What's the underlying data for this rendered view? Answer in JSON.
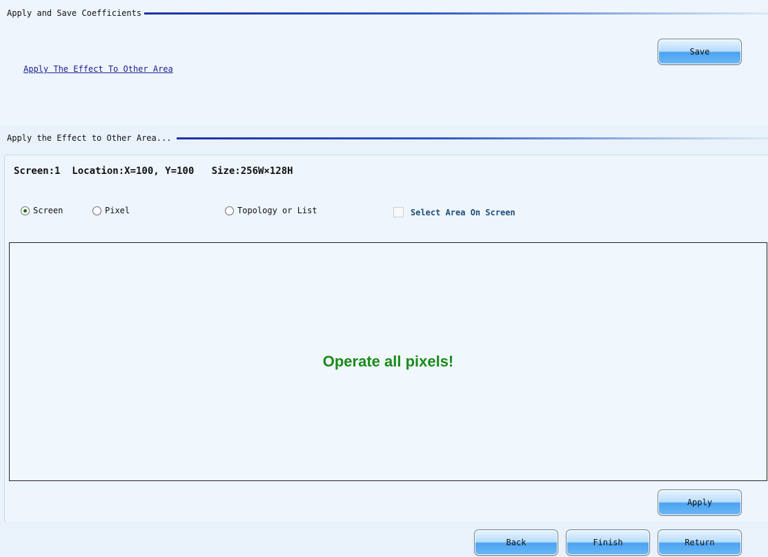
{
  "coefficients_section": {
    "title": "Apply and Save Coefficients",
    "apply_link": "Apply The Effect To Other Area",
    "save_button": "Save"
  },
  "area_section": {
    "title": "Apply the Effect to Other Area...",
    "info": "Screen:1  Location:X=100, Y=100   Size:256W×128H",
    "radios": [
      {
        "label": "Screen",
        "selected": true
      },
      {
        "label": "Pixel",
        "selected": false
      },
      {
        "label": "Topology or List",
        "selected": false
      }
    ],
    "select_area_checkbox": {
      "label": "Select Area On Screen",
      "checked": false
    },
    "canvas_message": "Operate all pixels!",
    "apply_button": "Apply"
  },
  "footer": {
    "back_button": "Back",
    "finish_button": "Finish",
    "return_button": "Return"
  },
  "colors": {
    "background": "#e9f2fa",
    "panel": "#eef5fc",
    "link": "#1a1f8f",
    "message": "#1a8a1a",
    "rule": "#1a2fa8"
  }
}
